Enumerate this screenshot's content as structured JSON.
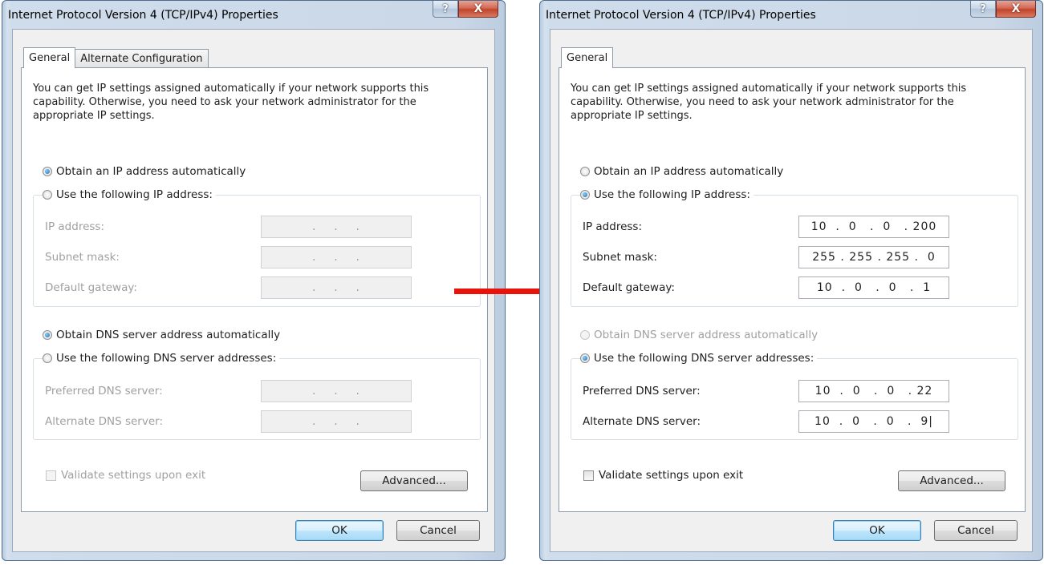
{
  "left_dialog": {
    "title": "Internet Protocol Version 4 (TCP/IPv4) Properties",
    "help_label": "?",
    "close_label": "X",
    "tabs": [
      "General",
      "Alternate Configuration"
    ],
    "description": "You can get IP settings assigned automatically if your network supports this capability. Otherwise, you need to ask your network administrator for the appropriate IP settings.",
    "ip_auto_label": "Obtain an IP address automatically",
    "ip_manual_label": "Use the following IP address:",
    "ip_mode": "automatic",
    "ip_address_label": "IP address:",
    "ip_address_value": ".    .    .",
    "subnet_label": "Subnet mask:",
    "subnet_value": ".    .    .",
    "gateway_label": "Default gateway:",
    "gateway_value": ".    .    .",
    "dns_auto_label": "Obtain DNS server address automatically",
    "dns_manual_label": "Use the following DNS server addresses:",
    "dns_mode": "automatic",
    "preferred_dns_label": "Preferred DNS server:",
    "preferred_dns_value": ".    .    .",
    "alternate_dns_label": "Alternate DNS server:",
    "alternate_dns_value": ".    .    .",
    "validate_label": "Validate settings upon exit",
    "validate_checked": false,
    "advanced_label": "Advanced...",
    "ok_label": "OK",
    "cancel_label": "Cancel"
  },
  "right_dialog": {
    "title": "Internet Protocol Version 4 (TCP/IPv4) Properties",
    "help_label": "?",
    "close_label": "X",
    "tabs": [
      "General"
    ],
    "description": "You can get IP settings assigned automatically if your network supports this capability. Otherwise, you need to ask your network administrator for the appropriate IP settings.",
    "ip_auto_label": "Obtain an IP address automatically",
    "ip_manual_label": "Use the following IP address:",
    "ip_mode": "manual",
    "ip_address_label": "IP address:",
    "ip_address_value": "10  .  0   .  0   . 200",
    "subnet_label": "Subnet mask:",
    "subnet_value": "255 . 255 . 255 .  0",
    "gateway_label": "Default gateway:",
    "gateway_value": "10  .  0   .  0   .  1",
    "dns_auto_label": "Obtain DNS server address automatically",
    "dns_manual_label": "Use the following DNS server addresses:",
    "dns_mode": "manual",
    "preferred_dns_label": "Preferred DNS server:",
    "preferred_dns_value": "10  .  0   .  0   . 22",
    "alternate_dns_label": "Alternate DNS server:",
    "alternate_dns_value": "10  .  0   .  0   .  9|",
    "validate_label": "Validate settings upon exit",
    "validate_checked": false,
    "advanced_label": "Advanced...",
    "ok_label": "OK",
    "cancel_label": "Cancel"
  },
  "arrow_color": "#e8140c"
}
